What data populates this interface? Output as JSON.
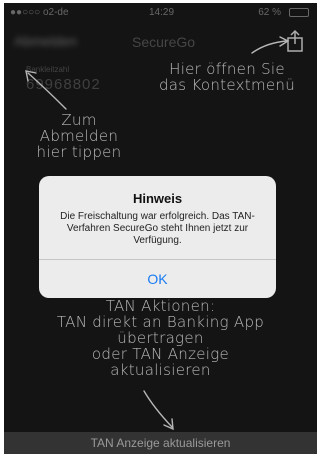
{
  "statusbar": {
    "carrier": "●●○○○ o2-de",
    "time": "14:29",
    "battery": "62 %",
    "wifi_icon": "wifi-icon",
    "battery_icon": "battery-icon"
  },
  "navbar": {
    "logout_label": "Abmelden",
    "title": "SecureGo",
    "share_icon": "share-icon"
  },
  "account": {
    "label": "Bankleitzahl",
    "value": "69968802"
  },
  "annotations": {
    "context_menu": [
      "Hier öffnen Sie",
      "das Kontextmenü"
    ],
    "logout": [
      "Zum",
      "Abmelden",
      "hier tippen"
    ],
    "tan_actions": [
      "TAN Aktionen:",
      "TAN direkt an Banking App",
      "übertragen",
      "oder TAN Anzeige",
      "aktualisieren"
    ]
  },
  "dialog": {
    "title": "Hinweis",
    "message": "Die Freischaltung war erfolgreich. Das TAN-Verfahren SecureGo steht Ihnen jetzt zur Verfügung.",
    "ok_label": "OK"
  },
  "bottom_button": {
    "label": "TAN Anzeige aktualisieren"
  },
  "colors": {
    "background": "#1b1b1b",
    "accent": "#1a7cf2",
    "dialog": "#ececec"
  }
}
